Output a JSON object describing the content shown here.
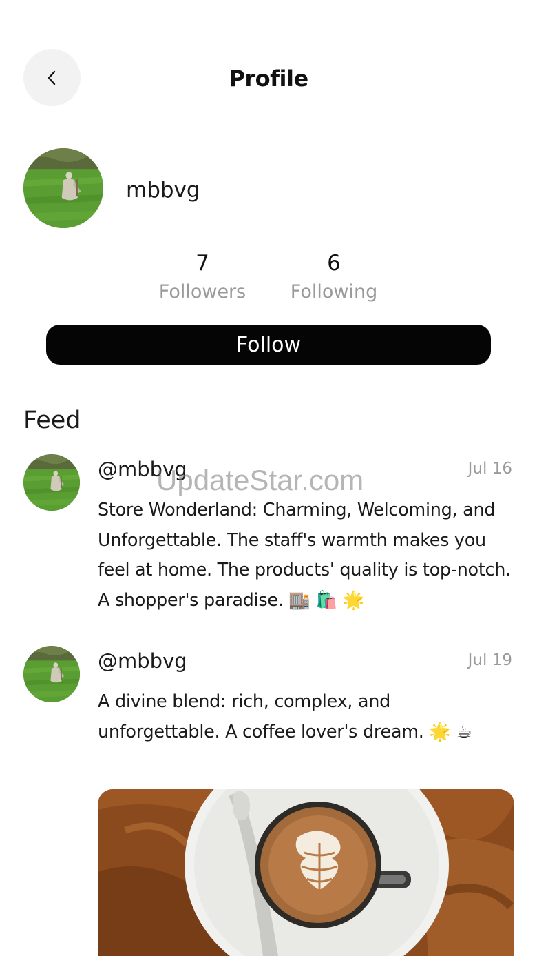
{
  "header": {
    "title": "Profile",
    "back_icon": "chevron-left-icon"
  },
  "profile": {
    "username": "mbbvg",
    "avatar": "avatar-photo-person-in-field",
    "followers_count": "7",
    "followers_label": "Followers",
    "following_count": "6",
    "following_label": "Following",
    "follow_label": "Follow"
  },
  "feed": {
    "title": "Feed",
    "posts": [
      {
        "handle": "@mbbvg",
        "date": "Jul 16",
        "text": "Store Wonderland: Charming, Welcoming, and Unforgettable. The staff's warmth makes you feel at home. The products' quality is top-notch. A shopper's paradise. 🏬 🛍️ 🌟"
      },
      {
        "handle": "@mbbvg",
        "date": "Jul 19",
        "text": "A divine blend: rich, complex, and unforgettable. A coffee lover's dream. 🌟 ☕",
        "image": "latte-art-coffee-cup-photo"
      }
    ]
  },
  "watermark": "UpdateStar.com",
  "colors": {
    "button_bg": "#050505",
    "button_text": "#ffffff",
    "muted_text": "#9a9a9a",
    "back_button_bg": "#f2f2f2"
  }
}
